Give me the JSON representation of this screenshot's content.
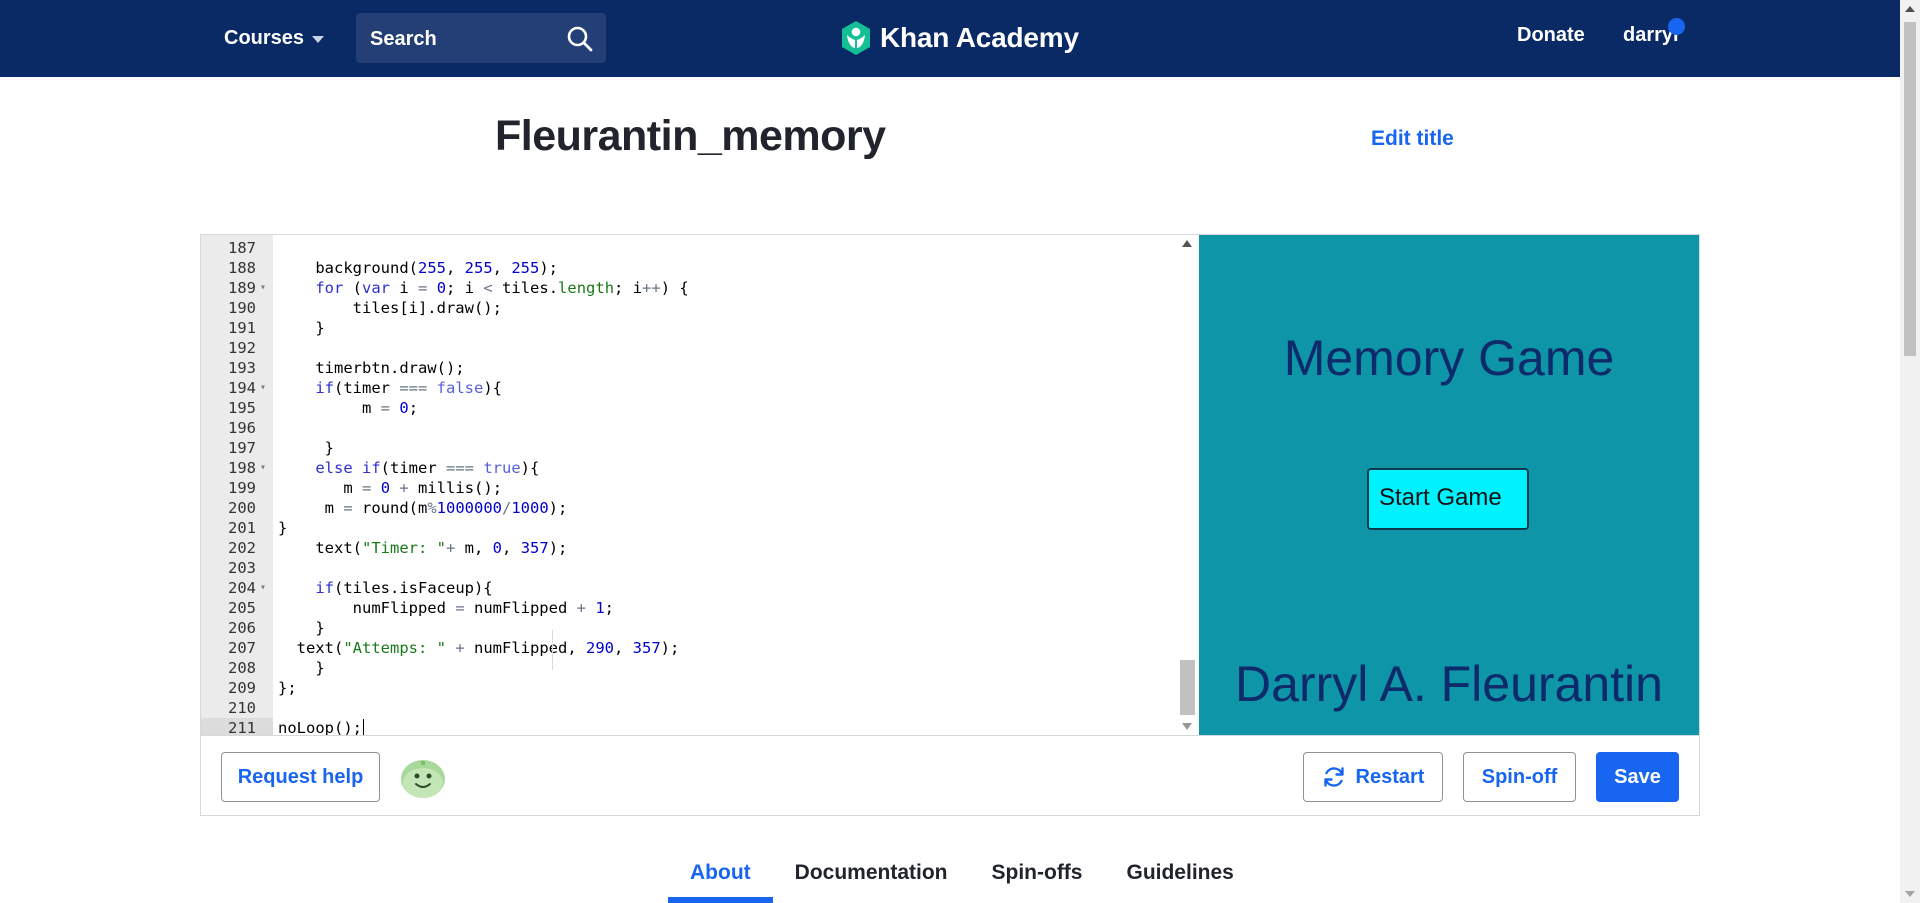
{
  "nav": {
    "courses_label": "Courses",
    "search_placeholder": "Search",
    "logo_text": "Khan Academy",
    "donate_label": "Donate",
    "username": "darryl",
    "colors": {
      "nav_bg": "#0a2a66",
      "accent": "#1865f2",
      "logo_leaf": "#14bf96"
    }
  },
  "project": {
    "title": "Fleurantin_memory",
    "edit_title_label": "Edit title"
  },
  "editor": {
    "lines": [
      {
        "n": "187",
        "html": ""
      },
      {
        "n": "188",
        "html": "    background(<span class='num'>255</span>, <span class='num'>255</span>, <span class='num'>255</span>);"
      },
      {
        "n": "189",
        "fold": true,
        "html": "    <span class='kw'>for</span> (<span class='kw'>var</span> i <span class='op'>=</span> <span class='num'>0</span>; i <span class='op'>&lt;</span> tiles.<span class='prop'>length</span>; i<span class='op'>++</span>) {"
      },
      {
        "n": "190",
        "html": "        tiles[i].draw();"
      },
      {
        "n": "191",
        "html": "    }"
      },
      {
        "n": "192",
        "html": ""
      },
      {
        "n": "193",
        "html": "    timerbtn.draw();"
      },
      {
        "n": "194",
        "fold": true,
        "html": "    <span class='kw'>if</span>(timer <span class='op'>===</span> <span class='bool'>false</span>){"
      },
      {
        "n": "195",
        "html": "         m <span class='op'>=</span> <span class='num'>0</span>;"
      },
      {
        "n": "196",
        "html": ""
      },
      {
        "n": "197",
        "html": "     }"
      },
      {
        "n": "198",
        "fold": true,
        "html": "    <span class='kw'>else</span> <span class='kw'>if</span>(timer <span class='op'>===</span> <span class='bool'>true</span>){"
      },
      {
        "n": "199",
        "html": "       m <span class='op'>=</span> <span class='num'>0</span> <span class='op'>+</span> millis();"
      },
      {
        "n": "200",
        "html": "     m <span class='op'>=</span> round(m<span class='op'>%</span><span class='num'>1000000</span><span class='op'>/</span><span class='num'>1000</span>);"
      },
      {
        "n": "201",
        "html": "}"
      },
      {
        "n": "202",
        "html": "    text(<span class='str'>\"Timer: \"</span><span class='op'>+</span> m, <span class='num'>0</span>, <span class='num'>357</span>);"
      },
      {
        "n": "203",
        "html": ""
      },
      {
        "n": "204",
        "fold": true,
        "html": "    <span class='kw'>if</span>(tiles.isFaceup){"
      },
      {
        "n": "205",
        "html": "        numFlipped <span class='op'>=</span> numFlipped <span class='op'>+</span> <span class='num'>1</span>;"
      },
      {
        "n": "206",
        "html": "    }"
      },
      {
        "n": "207",
        "html": "  text(<span class='str'>\"Attemps: \"</span> <span class='op'>+</span> numFlipped, <span class='num'>290</span>, <span class='num'>357</span>);"
      },
      {
        "n": "208",
        "html": "    }"
      },
      {
        "n": "209",
        "html": "};"
      },
      {
        "n": "210",
        "html": ""
      },
      {
        "n": "211",
        "active": true,
        "html": "noLoop();<span class='cursor'></span>"
      }
    ]
  },
  "canvas": {
    "game_title": "Memory Game",
    "start_button": "Start Game",
    "author": "Darryl A. Fleurantin",
    "colors": {
      "background": "#0f95a8",
      "text": "#0d2a6b",
      "button": "#00f2ff"
    }
  },
  "footer": {
    "request_help": "Request help",
    "restart": "Restart",
    "spinoff": "Spin-off",
    "save": "Save"
  },
  "tabs": [
    {
      "label": "About",
      "active": true
    },
    {
      "label": "Documentation",
      "active": false
    },
    {
      "label": "Spin-offs",
      "active": false
    },
    {
      "label": "Guidelines",
      "active": false
    }
  ]
}
